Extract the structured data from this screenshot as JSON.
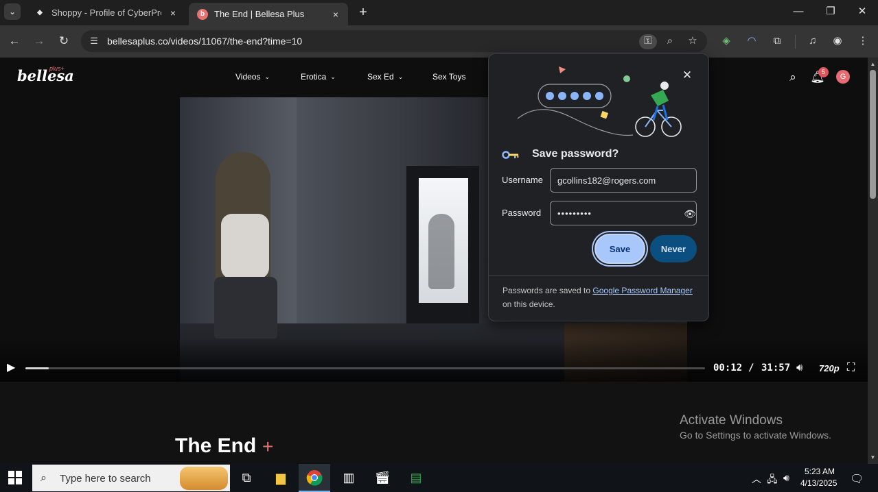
{
  "browser": {
    "tabs": [
      {
        "title": "Shoppy - Profile of CyberProMa",
        "active": false
      },
      {
        "title": "The End | Bellesa Plus",
        "active": true
      }
    ],
    "url": "bellesaplus.co/videos/11067/the-end?time=10",
    "window_controls": {
      "minimize": "—",
      "restore": "❐",
      "close": "✕"
    }
  },
  "site": {
    "logo": "bellesa",
    "logo_superscript": "plus+",
    "nav": [
      "Videos",
      "Erotica",
      "Sex Ed",
      "Sex Toys"
    ],
    "notification_count": "5",
    "avatar_initial": "G",
    "accent_color": "#e57373"
  },
  "player": {
    "time_current": "00:12",
    "time_separator": "/",
    "time_total": "31:57",
    "quality": "720p",
    "progress_fraction": 0.006
  },
  "video": {
    "title": "The End",
    "title_suffix": "+"
  },
  "password_popup": {
    "title": "Save password?",
    "username_label": "Username",
    "username_value": "gcollins182@rogers.com",
    "password_label": "Password",
    "password_value": "•••••••••",
    "save_label": "Save",
    "never_label": "Never",
    "footer_prefix": "Passwords are saved to ",
    "footer_link": "Google Password Manager",
    "footer_suffix": "on this device."
  },
  "watermark": {
    "line1": "Activate Windows",
    "line2": "Go to Settings to activate Windows."
  },
  "taskbar": {
    "search_placeholder": "Type here to search",
    "time": "5:23 AM",
    "date": "4/13/2025"
  }
}
